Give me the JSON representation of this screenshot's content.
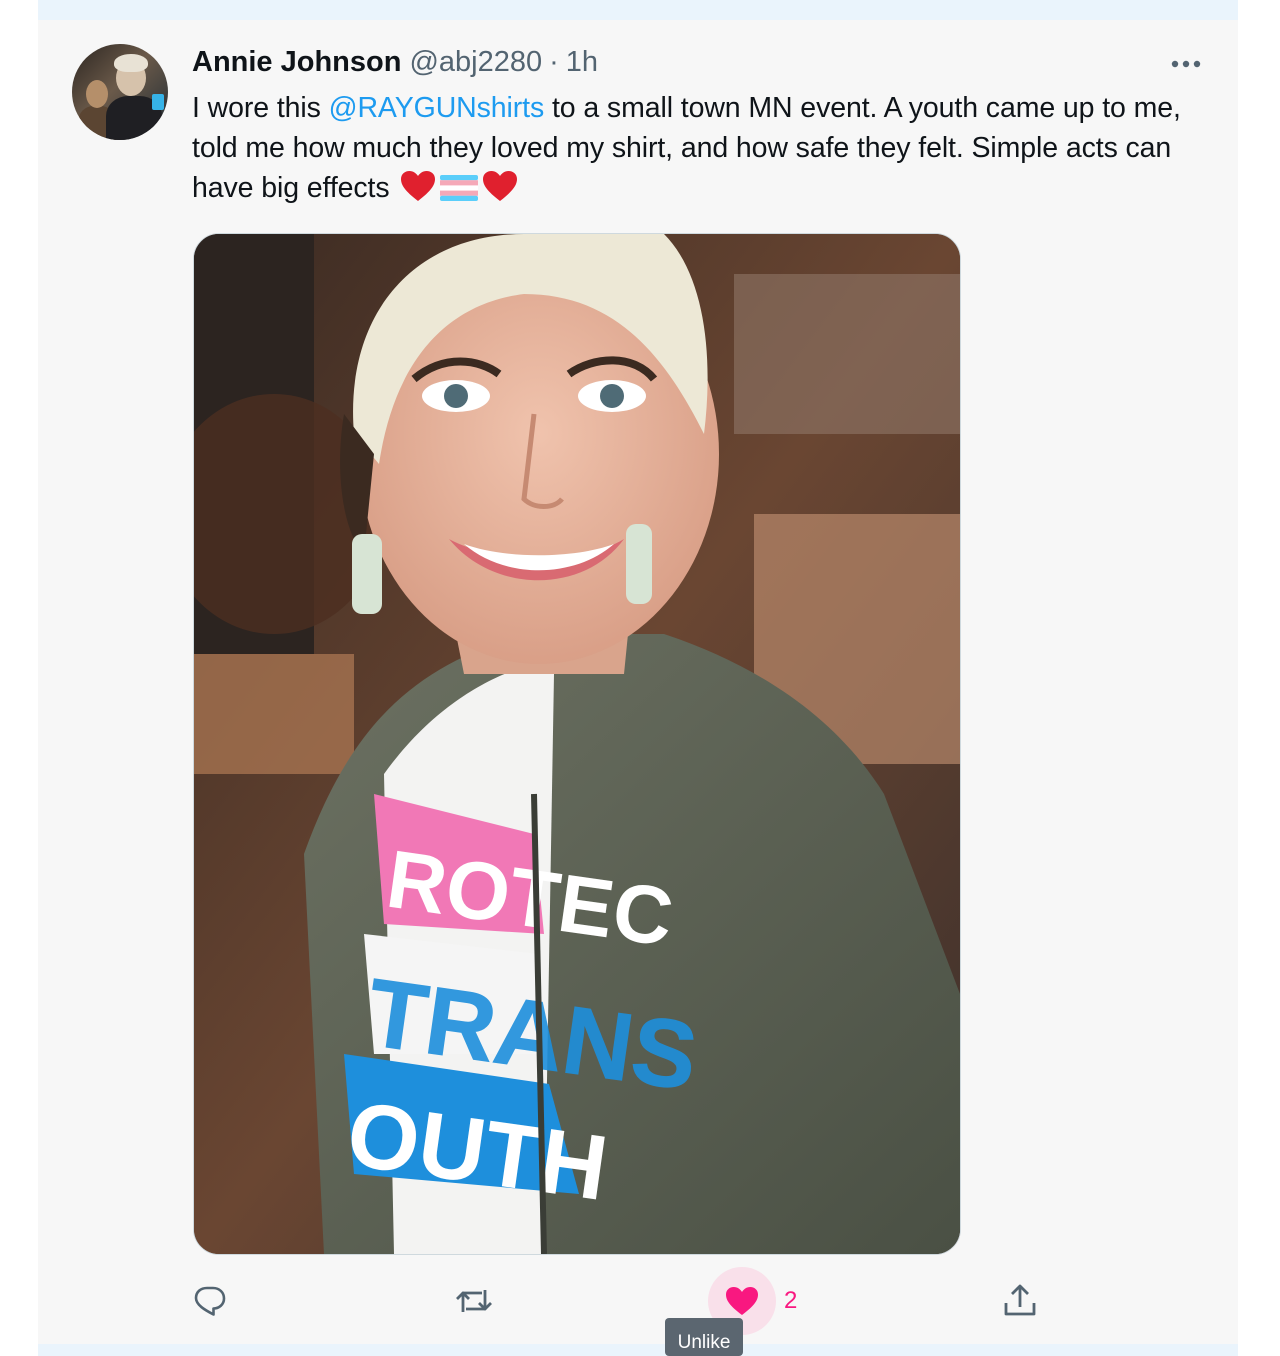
{
  "tweet": {
    "author_name": "Annie Johnson",
    "handle": "@abj2280",
    "separator": "·",
    "time": "1h",
    "text_before_mention": "I wore this ",
    "mention": "@RAYGUNshirts",
    "text_after_mention": " to a small town MN event. A youth came up to me, told me how much they loved my shirt, and how safe they felt. Simple acts can have big effects ",
    "emojis": [
      "red-heart",
      "transgender-flag",
      "red-heart"
    ],
    "shirt_print": [
      "PROTECT",
      "TRANS",
      "YOUTH"
    ],
    "more_icon": "ellipsis-icon"
  },
  "actions": {
    "reply_icon": "reply-icon",
    "retweet_icon": "retweet-icon",
    "like_icon": "heart-filled-icon",
    "like_count": "2",
    "like_color": "#f91880",
    "share_icon": "share-icon",
    "tooltip": "Unlike"
  },
  "colors": {
    "link": "#1d9bf0",
    "muted": "#536471",
    "text": "#0f1419"
  }
}
